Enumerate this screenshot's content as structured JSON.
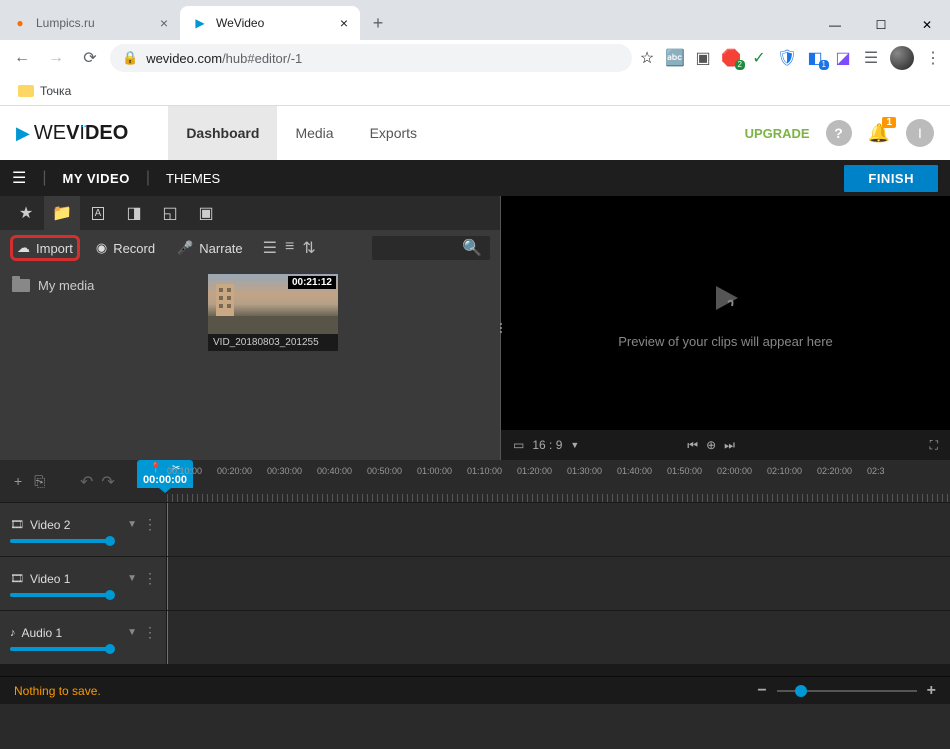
{
  "window": {
    "tabs": [
      {
        "title": "Lumpics.ru",
        "active": false
      },
      {
        "title": "WeVideo",
        "active": true
      }
    ]
  },
  "addr": {
    "domain": "wevideo.com",
    "path": "/hub#editor/-1"
  },
  "bookmarks": {
    "items": [
      "Точка"
    ]
  },
  "appHeader": {
    "logoP1": "WE",
    "logoP2": "V",
    "logoP3": "I",
    "logoP4": "DEO",
    "tabs": [
      "Dashboard",
      "Media",
      "Exports"
    ],
    "upgrade": "UPGRADE",
    "help": "?",
    "bellCount": "1",
    "userInitial": "I"
  },
  "subHeader": {
    "project": "MY VIDEO",
    "themes": "THEMES",
    "finish": "FINISH"
  },
  "actions": {
    "import": "Import",
    "record": "Record",
    "narrate": "Narrate"
  },
  "folders": {
    "myMedia": "My media"
  },
  "clip": {
    "duration": "00:21:12",
    "name": "VID_20180803_201255"
  },
  "preview": {
    "text": "Preview of your clips will appear here",
    "aspect": "16 : 9"
  },
  "playhead": {
    "time": "00:00:00"
  },
  "ruler": [
    "00:10:00",
    "00:20:00",
    "00:30:00",
    "00:40:00",
    "00:50:00",
    "01:00:00",
    "01:10:00",
    "01:20:00",
    "01:30:00",
    "01:40:00",
    "01:50:00",
    "02:00:00",
    "02:10:00",
    "02:20:00",
    "02:3"
  ],
  "tracks": {
    "v2": "Video 2",
    "v1": "Video 1",
    "a1": "Audio 1"
  },
  "status": {
    "text": "Nothing to save."
  }
}
